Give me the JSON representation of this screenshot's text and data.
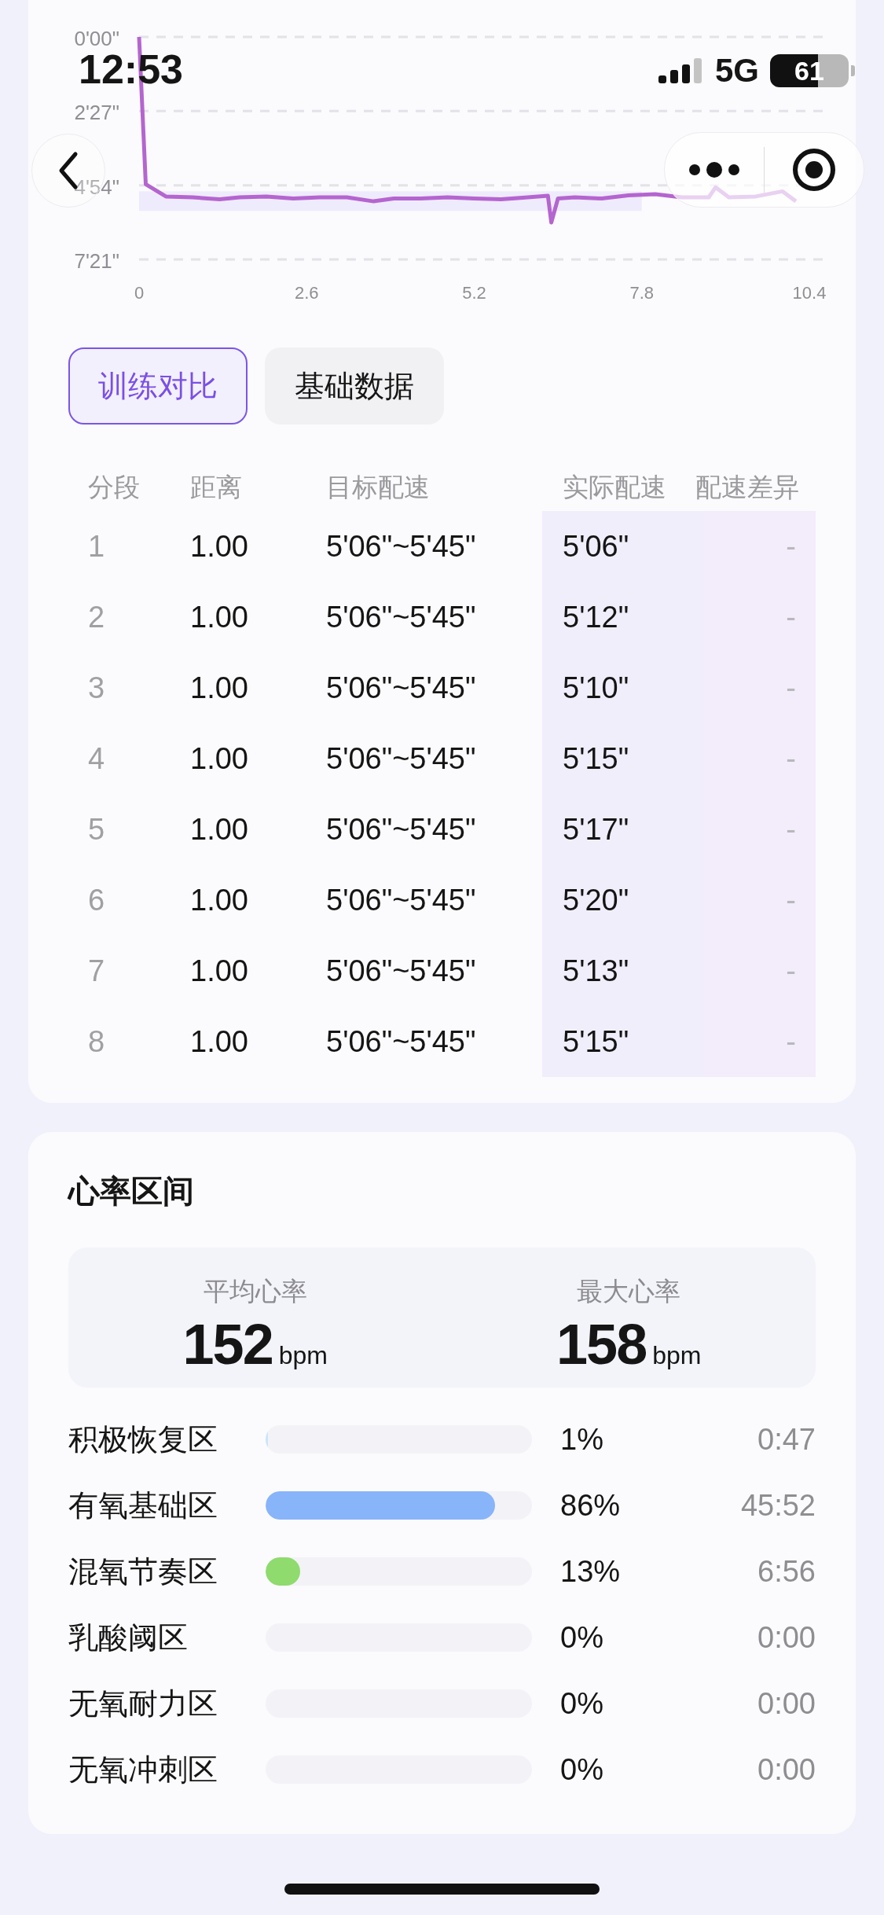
{
  "status_bar": {
    "time": "12:53",
    "network": "5G",
    "battery": "61"
  },
  "pace_chart": {
    "y_axis_labels": [
      "0'00\"",
      "2'27\"",
      "4'54\"",
      "7'21\""
    ],
    "x_axis_labels": [
      "0",
      "2.6",
      "5.2",
      "7.8",
      "10.4"
    ]
  },
  "tabs": [
    {
      "label": "训练对比",
      "selected": true
    },
    {
      "label": "基础数据",
      "selected": false
    }
  ],
  "splits_table": {
    "columns": [
      "分段",
      "距离",
      "目标配速",
      "实际配速",
      "配速差异"
    ],
    "rows": [
      [
        "1",
        "1.00",
        "5'06\"~5'45\"",
        "5'06\"",
        "-"
      ],
      [
        "2",
        "1.00",
        "5'06\"~5'45\"",
        "5'12\"",
        "-"
      ],
      [
        "3",
        "1.00",
        "5'06\"~5'45\"",
        "5'10\"",
        "-"
      ],
      [
        "4",
        "1.00",
        "5'06\"~5'45\"",
        "5'15\"",
        "-"
      ],
      [
        "5",
        "1.00",
        "5'06\"~5'45\"",
        "5'17\"",
        "-"
      ],
      [
        "6",
        "1.00",
        "5'06\"~5'45\"",
        "5'20\"",
        "-"
      ],
      [
        "7",
        "1.00",
        "5'06\"~5'45\"",
        "5'13\"",
        "-"
      ],
      [
        "8",
        "1.00",
        "5'06\"~5'45\"",
        "5'15\"",
        "-"
      ]
    ]
  },
  "heart_rate": {
    "title": "心率区间",
    "stats": [
      {
        "label": "平均心率",
        "value": "152",
        "unit": "bpm"
      },
      {
        "label": "最大心率",
        "value": "158",
        "unit": "bpm"
      }
    ],
    "zones": [
      {
        "name": "积极恢复区",
        "level": 0.01,
        "color": "#cbe5fa",
        "percent": "1%",
        "time": "0:47"
      },
      {
        "name": "有氧基础区",
        "level": 0.86,
        "color": "#88b4f9",
        "percent": "86%",
        "time": "45:52"
      },
      {
        "name": "混氧节奏区",
        "level": 0.13,
        "color": "#8fdb6e",
        "percent": "13%",
        "time": "6:56"
      },
      {
        "name": "乳酸阈区",
        "percent": "0%",
        "time": "0:00"
      },
      {
        "name": "无氧耐力区",
        "percent": "0%",
        "time": "0:00"
      },
      {
        "name": "无氧冲刺区",
        "percent": "0%",
        "time": "0:00"
      }
    ]
  }
}
